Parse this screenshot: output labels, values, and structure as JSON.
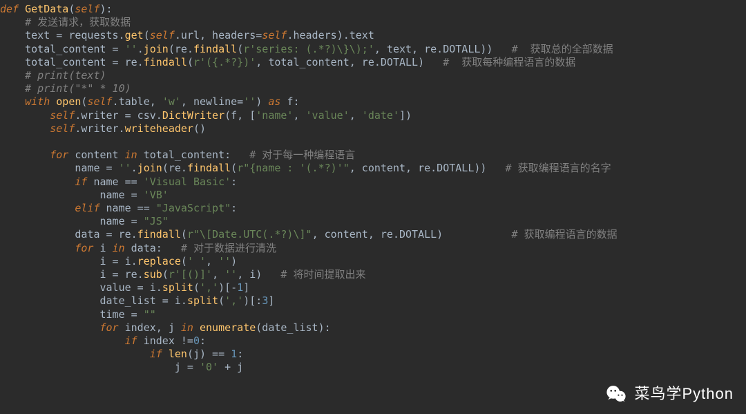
{
  "code": {
    "lines": [
      [
        {
          "c": "kw",
          "t": "def "
        },
        {
          "c": "fndef",
          "t": "GetData"
        },
        {
          "c": "pun",
          "t": "("
        },
        {
          "c": "kw",
          "t": "self"
        },
        {
          "c": "pun",
          "t": "):"
        }
      ],
      [
        {
          "c": "pun",
          "t": "    "
        },
        {
          "c": "cm",
          "t": "# 发送请求，获取数据"
        }
      ],
      [
        {
          "c": "pun",
          "t": "    text = requests."
        },
        {
          "c": "fn",
          "t": "get"
        },
        {
          "c": "pun",
          "t": "("
        },
        {
          "c": "kw",
          "t": "self"
        },
        {
          "c": "pun",
          "t": ".url, headers="
        },
        {
          "c": "kw",
          "t": "self"
        },
        {
          "c": "pun",
          "t": ".headers).text"
        }
      ],
      [
        {
          "c": "pun",
          "t": "    total_content = "
        },
        {
          "c": "str",
          "t": "''"
        },
        {
          "c": "pun",
          "t": "."
        },
        {
          "c": "fn",
          "t": "join"
        },
        {
          "c": "pun",
          "t": "(re."
        },
        {
          "c": "fn",
          "t": "findall"
        },
        {
          "c": "pun",
          "t": "("
        },
        {
          "c": "str",
          "t": "r'series: (.*?)\\}\\);'"
        },
        {
          "c": "pun",
          "t": ", text, re.DOTALL))   "
        },
        {
          "c": "cm",
          "t": "#  获取总的全部数据"
        }
      ],
      [
        {
          "c": "pun",
          "t": "    total_content = re."
        },
        {
          "c": "fn",
          "t": "findall"
        },
        {
          "c": "pun",
          "t": "("
        },
        {
          "c": "str",
          "t": "r'({.*?})'"
        },
        {
          "c": "pun",
          "t": ", total_content, re.DOTALL)   "
        },
        {
          "c": "cm",
          "t": "#  获取每种编程语言的数据"
        }
      ],
      [
        {
          "c": "pun",
          "t": "    "
        },
        {
          "c": "cmit",
          "t": "# print(text)"
        }
      ],
      [
        {
          "c": "pun",
          "t": "    "
        },
        {
          "c": "cmit",
          "t": "# print(\"*\" * 10)"
        }
      ],
      [
        {
          "c": "pun",
          "t": "    "
        },
        {
          "c": "kw",
          "t": "with "
        },
        {
          "c": "fn",
          "t": "open"
        },
        {
          "c": "pun",
          "t": "("
        },
        {
          "c": "kw",
          "t": "self"
        },
        {
          "c": "pun",
          "t": ".table, "
        },
        {
          "c": "str",
          "t": "'w'"
        },
        {
          "c": "pun",
          "t": ", newline="
        },
        {
          "c": "str",
          "t": "''"
        },
        {
          "c": "pun",
          "t": ") "
        },
        {
          "c": "kw",
          "t": "as "
        },
        {
          "c": "pun",
          "t": "f:"
        }
      ],
      [
        {
          "c": "pun",
          "t": "        "
        },
        {
          "c": "kw",
          "t": "self"
        },
        {
          "c": "pun",
          "t": ".writer = csv."
        },
        {
          "c": "fn",
          "t": "DictWriter"
        },
        {
          "c": "pun",
          "t": "(f, ["
        },
        {
          "c": "str",
          "t": "'name'"
        },
        {
          "c": "pun",
          "t": ", "
        },
        {
          "c": "str",
          "t": "'value'"
        },
        {
          "c": "pun",
          "t": ", "
        },
        {
          "c": "str",
          "t": "'date'"
        },
        {
          "c": "pun",
          "t": "])"
        }
      ],
      [
        {
          "c": "pun",
          "t": "        "
        },
        {
          "c": "kw",
          "t": "self"
        },
        {
          "c": "pun",
          "t": ".writer."
        },
        {
          "c": "fn",
          "t": "writeheader"
        },
        {
          "c": "pun",
          "t": "()"
        }
      ],
      [
        {
          "c": "pun",
          "t": ""
        }
      ],
      [
        {
          "c": "pun",
          "t": "        "
        },
        {
          "c": "kw",
          "t": "for "
        },
        {
          "c": "pun",
          "t": "content "
        },
        {
          "c": "kw",
          "t": "in "
        },
        {
          "c": "pun",
          "t": "total_content:   "
        },
        {
          "c": "cm",
          "t": "# 对于每一种编程语言"
        }
      ],
      [
        {
          "c": "pun",
          "t": "            name = "
        },
        {
          "c": "str",
          "t": "''"
        },
        {
          "c": "pun",
          "t": "."
        },
        {
          "c": "fn",
          "t": "join"
        },
        {
          "c": "pun",
          "t": "(re."
        },
        {
          "c": "fn",
          "t": "findall"
        },
        {
          "c": "pun",
          "t": "("
        },
        {
          "c": "str",
          "t": "r\"{name : '(.*?)'\""
        },
        {
          "c": "pun",
          "t": ", content, re.DOTALL))   "
        },
        {
          "c": "cm",
          "t": "# 获取编程语言的名字"
        }
      ],
      [
        {
          "c": "pun",
          "t": "            "
        },
        {
          "c": "kw",
          "t": "if "
        },
        {
          "c": "pun",
          "t": "name == "
        },
        {
          "c": "str",
          "t": "'Visual Basic'"
        },
        {
          "c": "pun",
          "t": ":"
        }
      ],
      [
        {
          "c": "pun",
          "t": "                name = "
        },
        {
          "c": "str",
          "t": "'VB'"
        }
      ],
      [
        {
          "c": "pun",
          "t": "            "
        },
        {
          "c": "kw",
          "t": "elif "
        },
        {
          "c": "pun",
          "t": "name == "
        },
        {
          "c": "str",
          "t": "\"JavaScript\""
        },
        {
          "c": "pun",
          "t": ":"
        }
      ],
      [
        {
          "c": "pun",
          "t": "                name = "
        },
        {
          "c": "str",
          "t": "\"JS\""
        }
      ],
      [
        {
          "c": "pun",
          "t": "            data = re."
        },
        {
          "c": "fn",
          "t": "findall"
        },
        {
          "c": "pun",
          "t": "("
        },
        {
          "c": "str",
          "t": "r\"\\[Date.UTC(.*?)\\]\""
        },
        {
          "c": "pun",
          "t": ", content, re.DOTALL)           "
        },
        {
          "c": "cm",
          "t": "# 获取编程语言的数据"
        }
      ],
      [
        {
          "c": "pun",
          "t": "            "
        },
        {
          "c": "kw",
          "t": "for "
        },
        {
          "c": "pun",
          "t": "i "
        },
        {
          "c": "kw",
          "t": "in "
        },
        {
          "c": "pun",
          "t": "data:   "
        },
        {
          "c": "cm",
          "t": "# 对于数据进行清洗"
        }
      ],
      [
        {
          "c": "pun",
          "t": "                i = i."
        },
        {
          "c": "fn",
          "t": "replace"
        },
        {
          "c": "pun",
          "t": "("
        },
        {
          "c": "str",
          "t": "' '"
        },
        {
          "c": "pun",
          "t": ", "
        },
        {
          "c": "str",
          "t": "''"
        },
        {
          "c": "pun",
          "t": ")"
        }
      ],
      [
        {
          "c": "pun",
          "t": "                i = re."
        },
        {
          "c": "fn",
          "t": "sub"
        },
        {
          "c": "pun",
          "t": "("
        },
        {
          "c": "str",
          "t": "r'[()]'"
        },
        {
          "c": "pun",
          "t": ", "
        },
        {
          "c": "str",
          "t": "''"
        },
        {
          "c": "pun",
          "t": ", i)   "
        },
        {
          "c": "cm",
          "t": "# 将时间提取出来"
        }
      ],
      [
        {
          "c": "pun",
          "t": "                value = i."
        },
        {
          "c": "fn",
          "t": "split"
        },
        {
          "c": "pun",
          "t": "("
        },
        {
          "c": "str",
          "t": "','"
        },
        {
          "c": "pun",
          "t": ")[-"
        },
        {
          "c": "num",
          "t": "1"
        },
        {
          "c": "pun",
          "t": "]"
        }
      ],
      [
        {
          "c": "pun",
          "t": "                date_list = i."
        },
        {
          "c": "fn",
          "t": "split"
        },
        {
          "c": "pun",
          "t": "("
        },
        {
          "c": "str",
          "t": "','"
        },
        {
          "c": "pun",
          "t": ")[:"
        },
        {
          "c": "num",
          "t": "3"
        },
        {
          "c": "pun",
          "t": "]"
        }
      ],
      [
        {
          "c": "pun",
          "t": "                time = "
        },
        {
          "c": "str",
          "t": "\"\""
        }
      ],
      [
        {
          "c": "pun",
          "t": "                "
        },
        {
          "c": "kw",
          "t": "for "
        },
        {
          "c": "pun",
          "t": "index, j "
        },
        {
          "c": "kw",
          "t": "in "
        },
        {
          "c": "fn",
          "t": "enumerate"
        },
        {
          "c": "pun",
          "t": "(date_list):"
        }
      ],
      [
        {
          "c": "pun",
          "t": "                    "
        },
        {
          "c": "kw",
          "t": "if "
        },
        {
          "c": "pun",
          "t": "index !="
        },
        {
          "c": "num",
          "t": "0"
        },
        {
          "c": "pun",
          "t": ":"
        }
      ],
      [
        {
          "c": "pun",
          "t": "                        "
        },
        {
          "c": "kw",
          "t": "if "
        },
        {
          "c": "fn",
          "t": "len"
        },
        {
          "c": "pun",
          "t": "(j) == "
        },
        {
          "c": "num",
          "t": "1"
        },
        {
          "c": "pun",
          "t": ":"
        }
      ],
      [
        {
          "c": "pun",
          "t": "                            j = "
        },
        {
          "c": "str",
          "t": "'0'"
        },
        {
          "c": "pun",
          "t": " + j"
        }
      ]
    ]
  },
  "watermark": {
    "label": "菜鸟学Python"
  }
}
